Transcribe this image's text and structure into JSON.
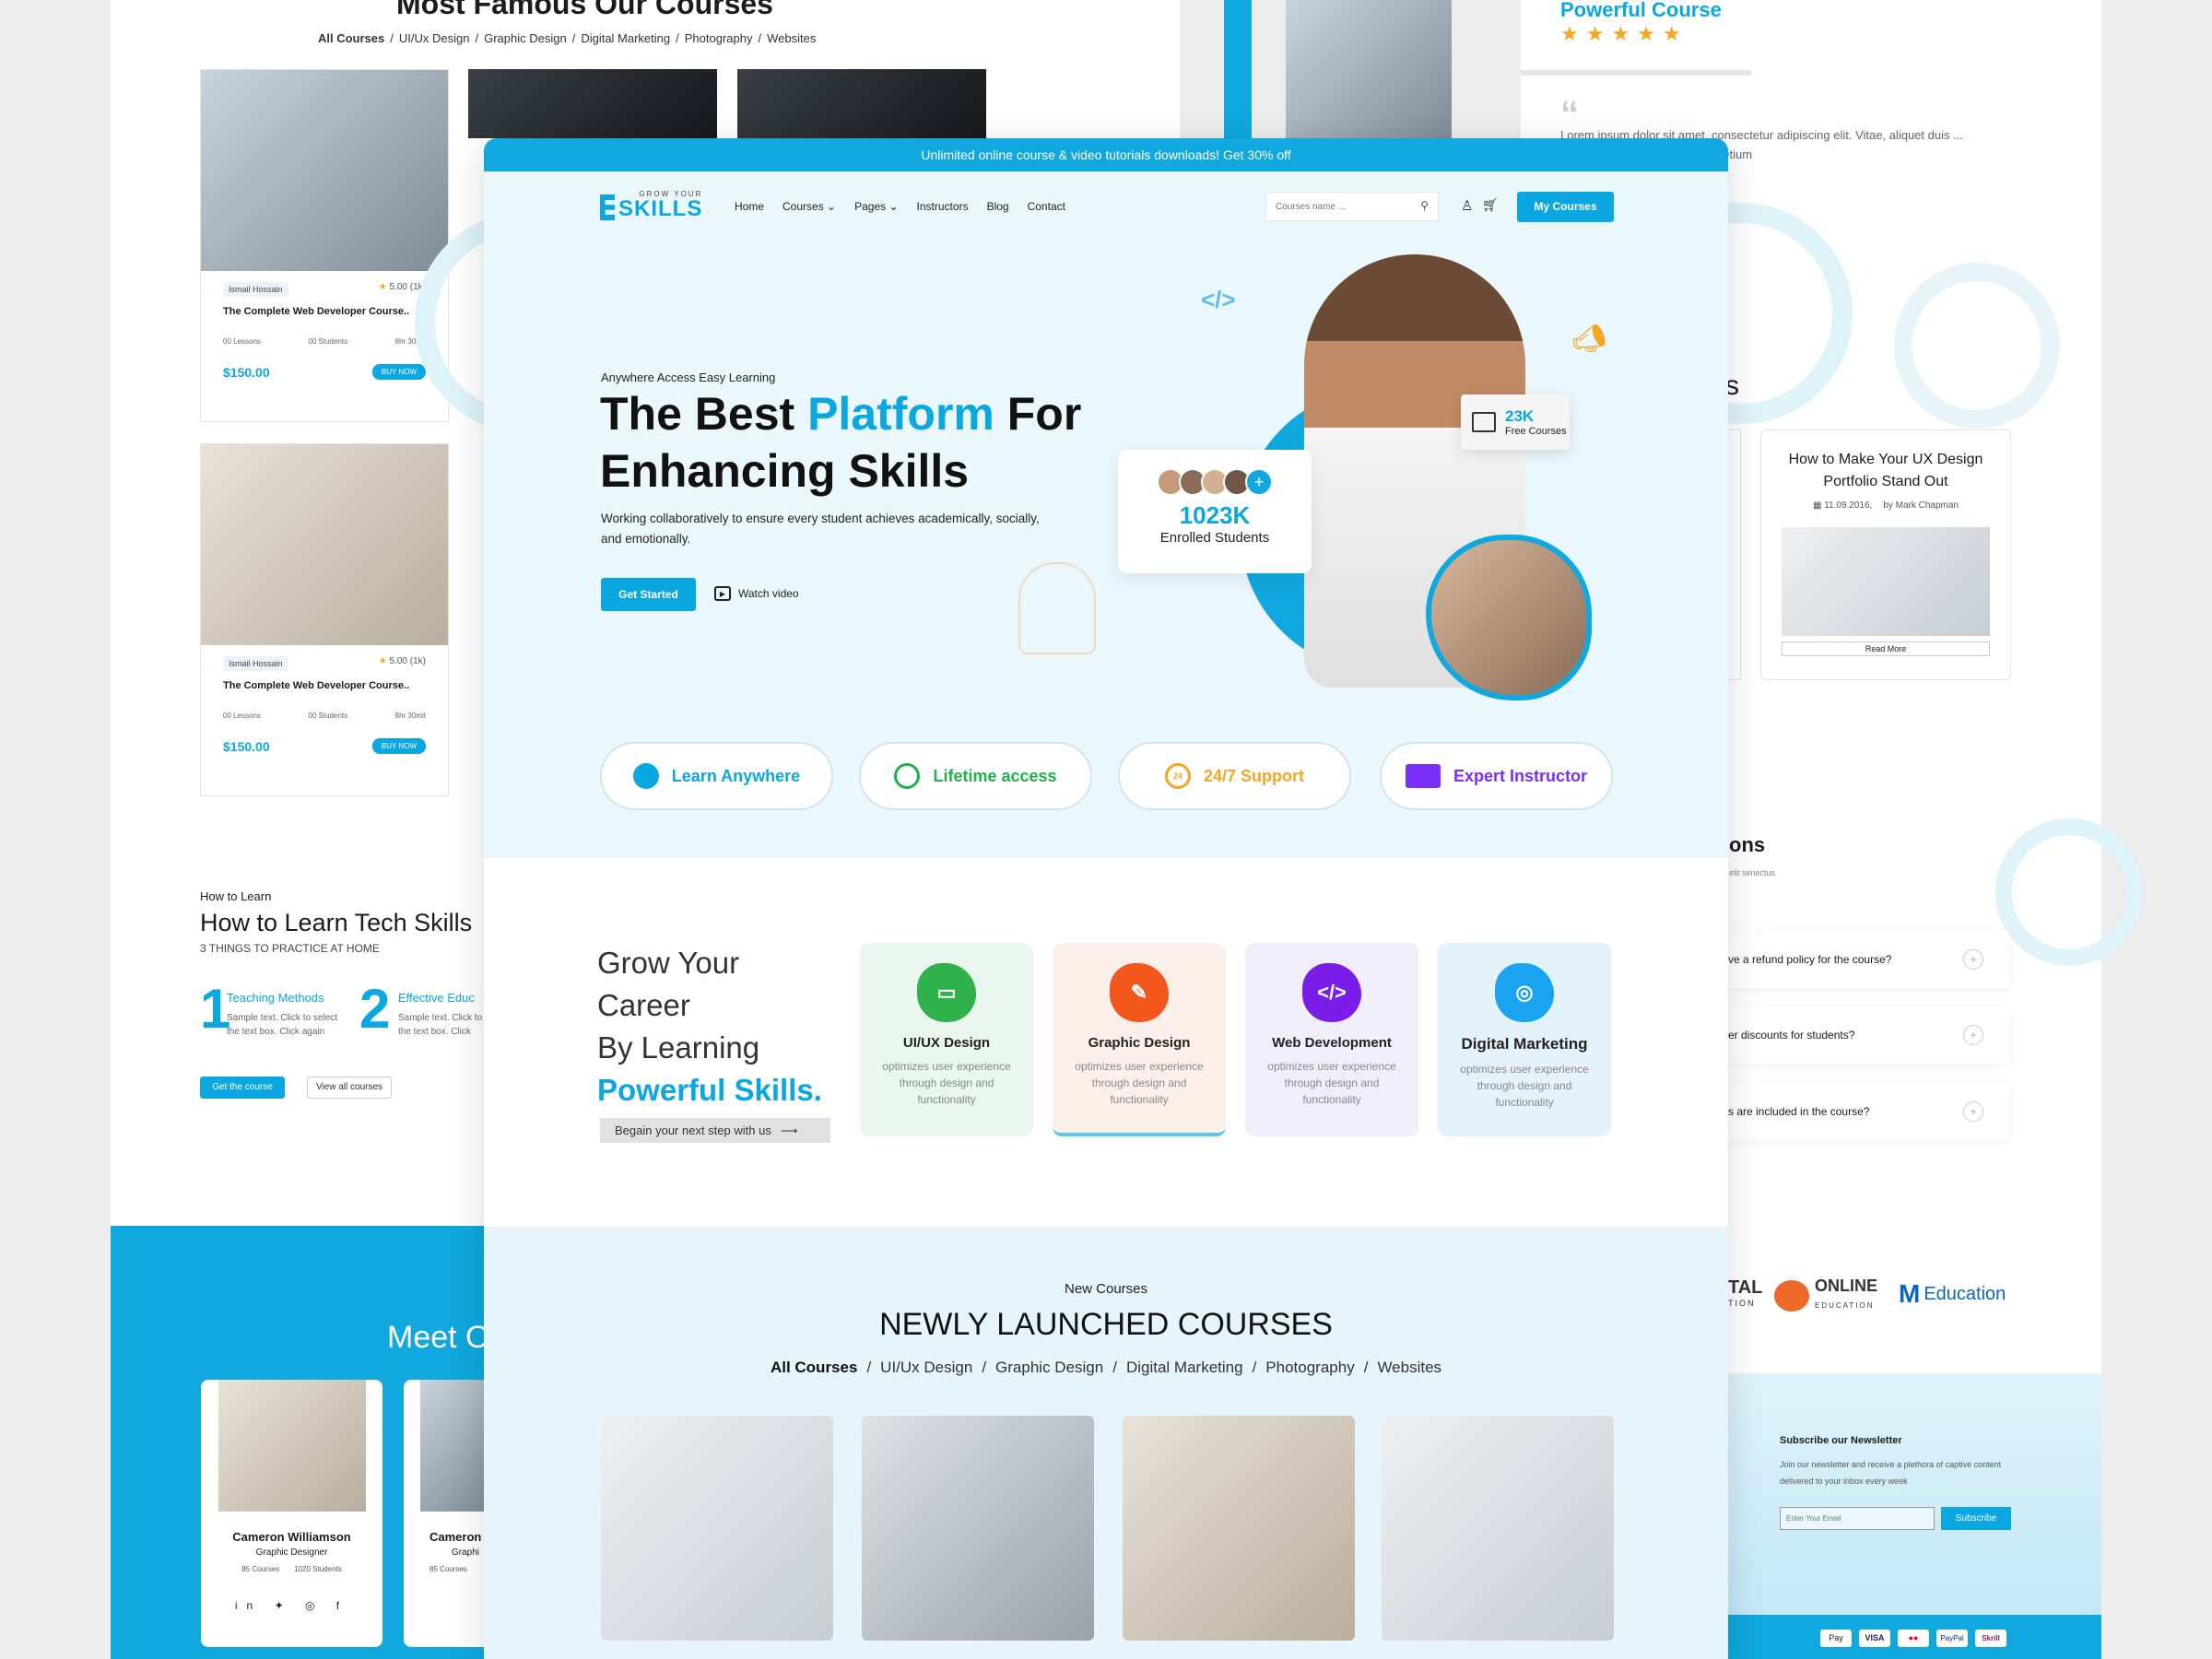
{
  "bg_left": {
    "section_title": "Most Famous Our Courses",
    "filters": [
      "All Courses",
      "UI/Ux Design",
      "Graphic Design",
      "Digital Marketing",
      "Photography",
      "Websites"
    ],
    "cards": [
      {
        "instructor": "Ismail Hossain",
        "rating": "5.00 (1k)",
        "title": "The Complete Web Developer Course..",
        "lessons": "00 Lessons",
        "students": "00 Students",
        "duration": "8hr 30mit",
        "price": "$150.00",
        "cta": "BUY NOW"
      },
      {
        "instructor": "Ismail Hossain",
        "rating": "5.00 (1k)",
        "title": "The Complete Web Developer Course..",
        "lessons": "00 Lessons",
        "students": "00 Students",
        "duration": "8hr 30mit",
        "price": "$150.00",
        "cta": "BUY NOW"
      }
    ],
    "learn": {
      "eyebrow": "How to Learn",
      "title": "How to Learn Tech Skills",
      "subtitle": "3 THINGS TO PRACTICE AT HOME",
      "steps": [
        {
          "num": "1",
          "title": "Teaching Methods",
          "text": "Sample text. Click to select the text box. Click again"
        },
        {
          "num": "2",
          "title": "Effective Educ",
          "text": "Sample text. Click to the text box. Click ag"
        }
      ],
      "btn_primary": "Get the course",
      "btn_secondary": "View all courses"
    },
    "meet": "Meet O",
    "instructors": [
      {
        "name": "Cameron Williamson",
        "role": "Graphic Designer",
        "courses": "85 Courses",
        "students": "1020 Students"
      },
      {
        "name": "Cameron",
        "role": "Graphi",
        "courses": "85 Courses",
        "students": ""
      }
    ]
  },
  "bg_right": {
    "powerful": "Powerful Course",
    "stars": "★★★★★",
    "quote": "Lorem ipsum dolor sit amet, consectetur adipiscing elit. Vitae, aliquet duis ... Vestibulum nunc diam tellus pretium",
    "s_letter": "s",
    "blog": {
      "title": "How to Make Your UX Design Portfolio Stand Out",
      "date": "11.09.2016,",
      "author": "by Mark Chapman",
      "read_more": "Read More"
    },
    "faq_title": "ons",
    "faq_sub": "elit senectus",
    "faqs": [
      "ve a refund policy for the course?",
      "er discounts for students?",
      "s are included in the course?"
    ],
    "partners": [
      "TAL",
      "ONLINE",
      "Education"
    ],
    "partners_sub": [
      "TION",
      "EDUCATION"
    ],
    "newsletter": {
      "title": "Subscribe our Newsletter",
      "text": "Join our newsletter and receive a plethora of captive content delivered to your inbox every week",
      "placeholder": "Enter Your Email",
      "button": "Subscribe"
    },
    "payments": [
      "Pay",
      "VISA",
      "●●",
      "PayPal",
      "Skrill"
    ]
  },
  "promo": "Unlimited online course & video tutorials downloads! Get 30% off",
  "nav": {
    "logo_top": "GROW YOUR",
    "logo_main": "SKILLS",
    "items": [
      "Home",
      "Courses",
      "Pages",
      "Instructors",
      "Blog",
      "Contact"
    ],
    "search_placeholder": "Courses name ...",
    "my_courses": "My Courses"
  },
  "hero": {
    "eyebrow": "Anywhere Access Easy Learning",
    "title_1": "The Best ",
    "title_highlight": "Platform",
    "title_2": " For",
    "title_3": "Enhancing Skills",
    "desc": "Working collaboratively to ensure every student achieves academically, socially, and emotionally.",
    "cta": "Get Started",
    "watch": "Watch video",
    "free_count": "23K",
    "free_label": "Free Courses",
    "enrolled_count": "1023K",
    "enrolled_label": "Enrolled  Students"
  },
  "features": [
    {
      "label": "Learn Anywhere",
      "color": "#0aa7e0"
    },
    {
      "label": "Lifetime access",
      "color": "#22b04b"
    },
    {
      "label": "24/7 Support",
      "color": "#f5a623"
    },
    {
      "label": "Expert Instructor",
      "color": "#7b2ff7"
    }
  ],
  "career": {
    "l1": "Grow Your",
    "l2": "Career",
    "l3": "By Learning",
    "l4": "Powerful Skills.",
    "link": "Begain your next step with us"
  },
  "skills": [
    {
      "title": "UI/UX  Design",
      "desc": "optimizes user experience through design and functionality",
      "bg": "#e9f7ee",
      "icon_bg": "#2fb14b"
    },
    {
      "title": "Graphic Design",
      "desc": "optimizes user experience through design and functionality",
      "bg": "#fdf0ea",
      "icon_bg": "#f4571c"
    },
    {
      "title": "Web Development",
      "desc": "optimizes user experience through design and functionality",
      "bg": "#f1eefc",
      "icon_bg": "#7b1de8"
    },
    {
      "title": "Digital Marketing",
      "desc": "optimizes user experience through design and functionality",
      "bg": "#e3f2fc",
      "icon_bg": "#1aa3ef"
    }
  ],
  "new_courses": {
    "eyebrow": "New Courses",
    "title": "NEWLY LAUNCHED COURSES",
    "filters": [
      "All Courses",
      "UI/Ux Design",
      "Graphic Design",
      "Digital Marketing",
      "Photography",
      "Websites"
    ]
  }
}
